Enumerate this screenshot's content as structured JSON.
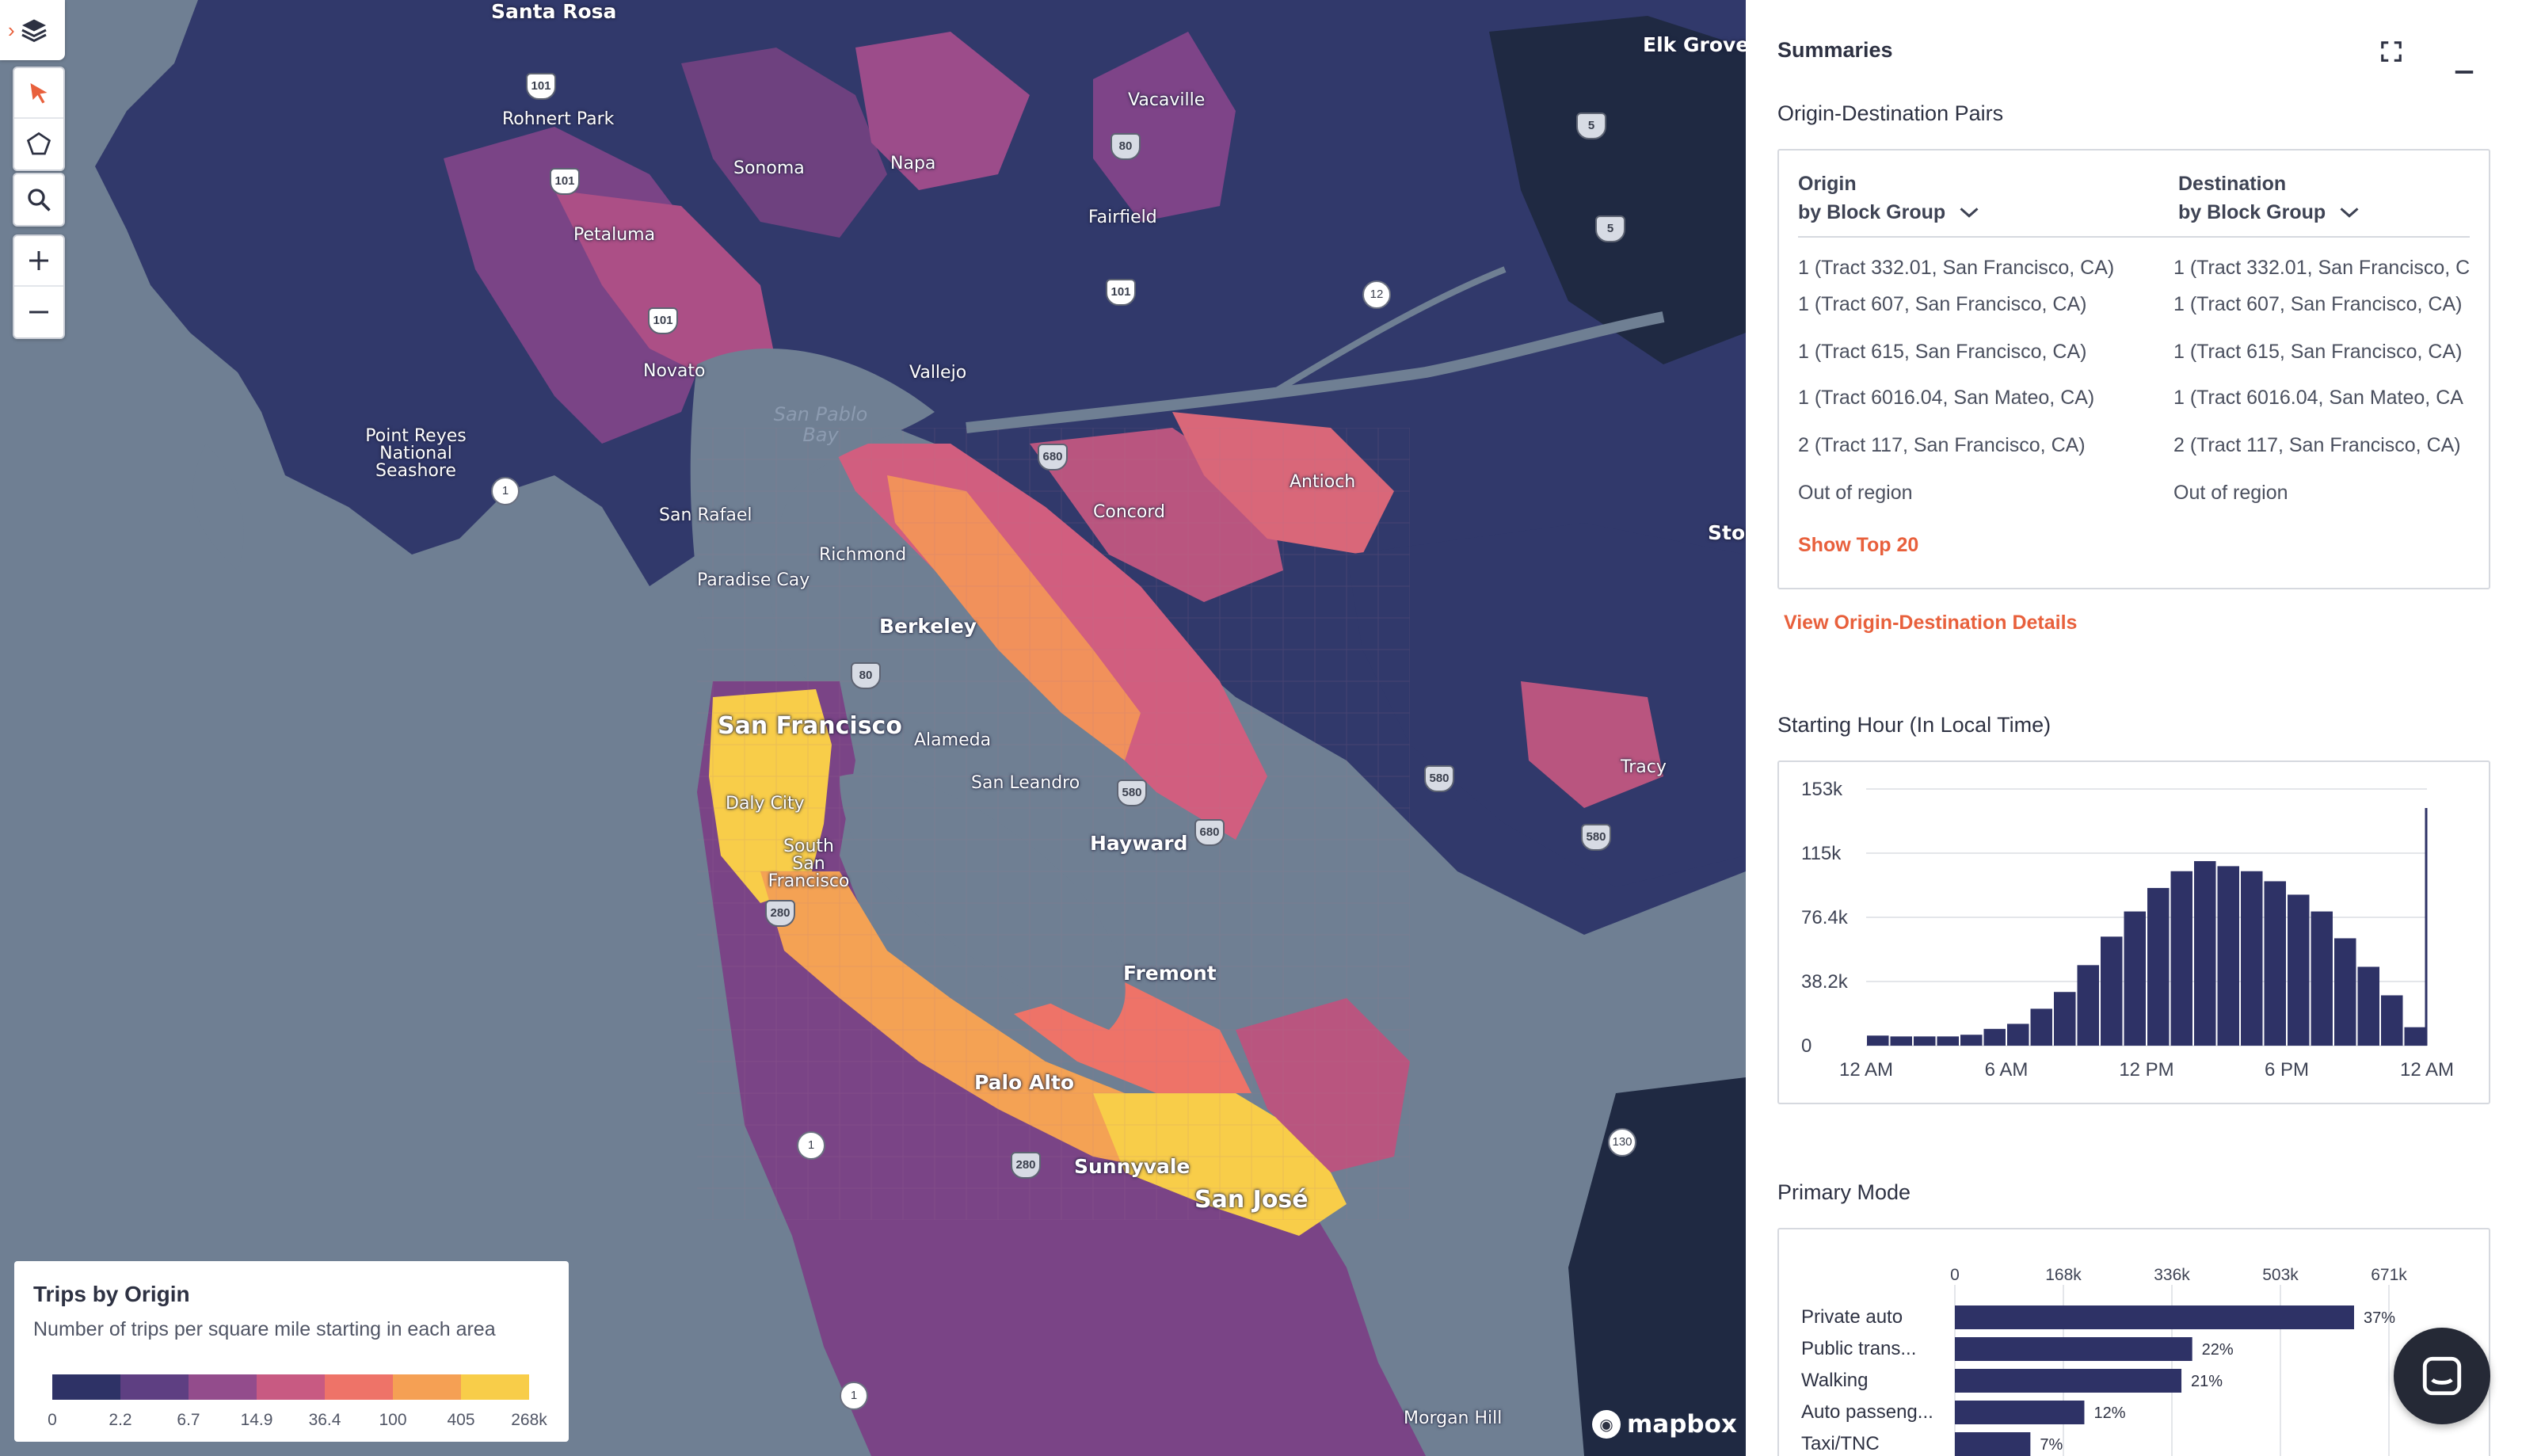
{
  "map": {
    "places": [
      {
        "name": "Santa Rosa",
        "cls": "mid"
      },
      {
        "name": "Rohnert Park",
        "cls": ""
      },
      {
        "name": "Sonoma",
        "cls": ""
      },
      {
        "name": "Napa",
        "cls": ""
      },
      {
        "name": "Petaluma",
        "cls": ""
      },
      {
        "name": "Vacaville",
        "cls": ""
      },
      {
        "name": "Fairfield",
        "cls": ""
      },
      {
        "name": "Elk Grove",
        "cls": "mid"
      },
      {
        "name": "Novato",
        "cls": ""
      },
      {
        "name": "Vallejo",
        "cls": ""
      },
      {
        "name": "Point Reyes National Seashore",
        "cls": ""
      },
      {
        "name": "San Pablo Bay",
        "cls": "water"
      },
      {
        "name": "San Rafael",
        "cls": ""
      },
      {
        "name": "Concord",
        "cls": ""
      },
      {
        "name": "Antioch",
        "cls": ""
      },
      {
        "name": "Richmond",
        "cls": ""
      },
      {
        "name": "Paradise Cay",
        "cls": ""
      },
      {
        "name": "Berkeley",
        "cls": "mid"
      },
      {
        "name": "Stoc",
        "cls": "mid"
      },
      {
        "name": "San Francisco",
        "cls": "big"
      },
      {
        "name": "Alameda",
        "cls": ""
      },
      {
        "name": "San Leandro",
        "cls": ""
      },
      {
        "name": "Daly City",
        "cls": ""
      },
      {
        "name": "Tracy",
        "cls": ""
      },
      {
        "name": "Hayward",
        "cls": "mid"
      },
      {
        "name": "South San Francisco",
        "cls": ""
      },
      {
        "name": "Fremont",
        "cls": "mid"
      },
      {
        "name": "Palo Alto",
        "cls": "mid"
      },
      {
        "name": "Sunnyvale",
        "cls": "mid"
      },
      {
        "name": "San José",
        "cls": "big"
      },
      {
        "name": "Morgan Hill",
        "cls": ""
      }
    ],
    "shields": [
      "101",
      "101",
      "101",
      "101",
      "80",
      "80",
      "680",
      "680",
      "580",
      "580",
      "580",
      "280",
      "280",
      "5",
      "5"
    ],
    "circle_shields": [
      "1",
      "1",
      "1",
      "12",
      "130"
    ],
    "controls": [
      "layers-icon",
      "select-arrow-icon",
      "polygon-select-icon",
      "search-icon",
      "zoom-in-icon",
      "zoom-out-icon"
    ],
    "attribution": "mapbox"
  },
  "legend": {
    "title": "Trips by Origin",
    "subtitle": "Number of trips per square mile starting in each area",
    "colors": [
      "#2e3266",
      "#5e3f82",
      "#934c8c",
      "#c85a82",
      "#ee7368",
      "#f5a054",
      "#f8cd49"
    ],
    "ticks": [
      "0",
      "2.2",
      "6.7",
      "14.9",
      "36.4",
      "100",
      "405",
      "268k"
    ]
  },
  "panel": {
    "title": "Summaries",
    "od": {
      "heading": "Origin-Destination Pairs",
      "origin_label": "Origin",
      "origin_sub": "by Block Group",
      "dest_label": "Destination",
      "dest_sub": "by Block Group",
      "rows": [
        {
          "origin": "1 (Tract 332.01, San Francisco, CA)",
          "dest": "1 (Tract 332.01, San Francisco, C"
        },
        {
          "origin": "1 (Tract 607, San Francisco, CA)",
          "dest": "1 (Tract 607, San Francisco, CA)"
        },
        {
          "origin": "1 (Tract 615, San Francisco, CA)",
          "dest": "1 (Tract 615, San Francisco, CA)"
        },
        {
          "origin": "1 (Tract 6016.04, San Mateo, CA)",
          "dest": "1 (Tract 6016.04, San Mateo, CA"
        },
        {
          "origin": "2 (Tract 117, San Francisco, CA)",
          "dest": "2 (Tract 117, San Francisco, CA)"
        },
        {
          "origin": "Out of region",
          "dest": "Out of region"
        }
      ],
      "show_top": "Show Top 20",
      "details_link": "View Origin-Destination Details"
    },
    "hour_heading": "Starting Hour (In Local Time)",
    "mode_heading": "Primary Mode"
  },
  "chart_data": [
    {
      "type": "bar",
      "title": "Starting Hour (In Local Time)",
      "xlabel": "",
      "ylabel": "",
      "categories": [
        "0",
        "1",
        "2",
        "3",
        "4",
        "5",
        "6",
        "7",
        "8",
        "9",
        "10",
        "11",
        "12",
        "13",
        "14",
        "15",
        "16",
        "17",
        "18",
        "19",
        "20",
        "21",
        "22",
        "23"
      ],
      "values": [
        6000,
        5500,
        5500,
        5500,
        6500,
        10000,
        13000,
        22000,
        32000,
        48000,
        65000,
        80000,
        94000,
        104000,
        110000,
        107000,
        104000,
        98000,
        90000,
        80000,
        64000,
        47000,
        30000,
        11000
      ],
      "ylim": [
        0,
        153000
      ],
      "y_ticks": [
        "153k",
        "115k",
        "76.4k",
        "38.2k",
        "0"
      ],
      "x_ticks": [
        "12 AM",
        "6 AM",
        "12 PM",
        "6 PM",
        "12 AM"
      ],
      "grid": true
    },
    {
      "type": "bar",
      "orientation": "horizontal",
      "title": "Primary Mode",
      "xlabel": "",
      "ylabel": "",
      "categories": [
        "Private auto",
        "Public trans...",
        "Walking",
        "Auto passeng...",
        "Taxi/TNC"
      ],
      "values": [
        37,
        22,
        21,
        12,
        7
      ],
      "value_labels": [
        "37%",
        "22%",
        "21%",
        "12%",
        "7%"
      ],
      "x_ticks": [
        "0",
        "168k",
        "336k",
        "503k",
        "671k"
      ],
      "xlim": [
        0,
        100
      ],
      "grid": true
    }
  ]
}
